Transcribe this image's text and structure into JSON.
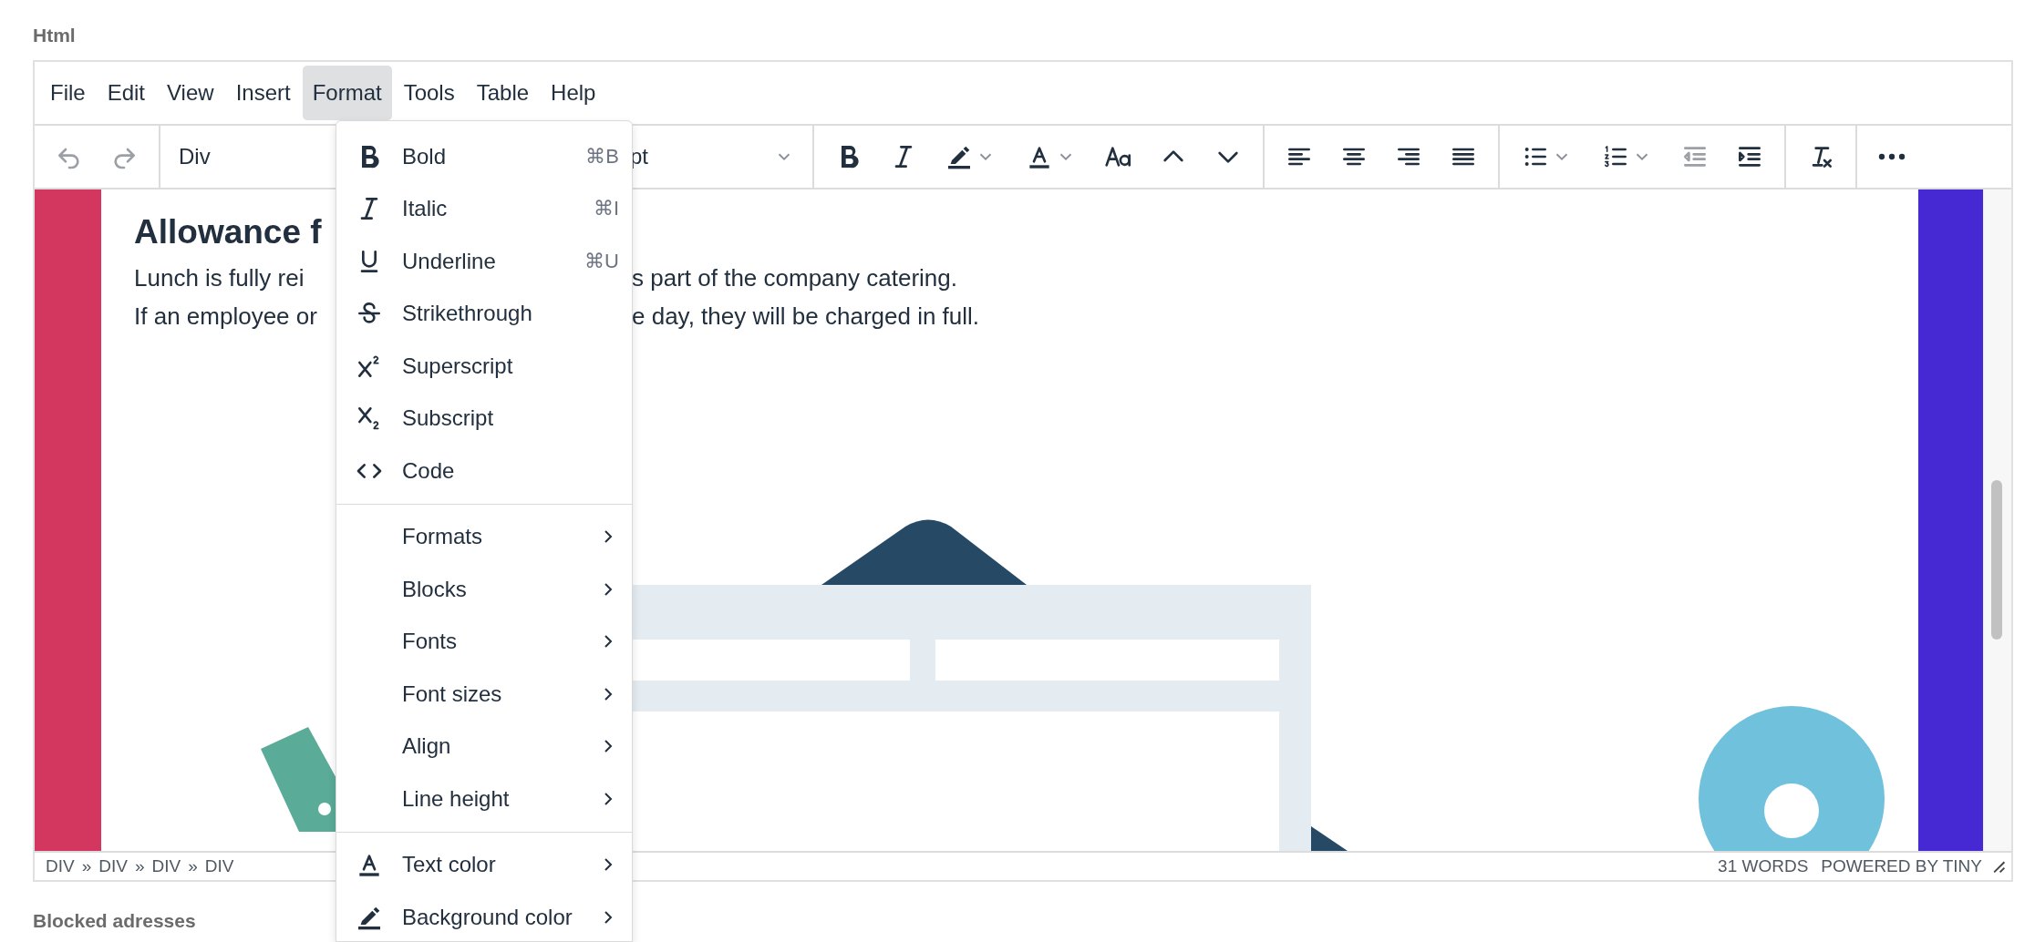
{
  "field_label": "Html",
  "menubar": [
    {
      "label": "File",
      "selected": false
    },
    {
      "label": "Edit",
      "selected": false
    },
    {
      "label": "View",
      "selected": false
    },
    {
      "label": "Insert",
      "selected": false
    },
    {
      "label": "Format",
      "selected": true
    },
    {
      "label": "Tools",
      "selected": false
    },
    {
      "label": "Table",
      "selected": false
    },
    {
      "label": "Help",
      "selected": false
    }
  ],
  "toolbar": {
    "history": [
      {
        "kind": "button",
        "disabled": true
      },
      {
        "kind": "button",
        "disabled": true
      }
    ],
    "selects": [
      {
        "value": "Div"
      },
      {
        "value": "pt"
      }
    ],
    "groups": [
      [
        {
          "kind": "button",
          "disabled": false
        },
        {
          "kind": "button",
          "disabled": false
        },
        {
          "kind": "split",
          "disabled": false
        },
        {
          "kind": "split",
          "disabled": false
        },
        {
          "kind": "button",
          "disabled": false
        },
        {
          "kind": "button",
          "disabled": false
        },
        {
          "kind": "button",
          "disabled": false
        }
      ],
      [
        {
          "kind": "button",
          "disabled": false
        },
        {
          "kind": "button",
          "disabled": false
        },
        {
          "kind": "button",
          "disabled": false
        },
        {
          "kind": "button",
          "disabled": false
        }
      ],
      [
        {
          "kind": "split",
          "disabled": false
        },
        {
          "kind": "split",
          "disabled": false
        },
        {
          "kind": "button",
          "disabled": true
        },
        {
          "kind": "button",
          "disabled": false
        }
      ],
      [
        {
          "kind": "button",
          "disabled": false
        }
      ],
      [
        {
          "kind": "button",
          "disabled": false
        }
      ]
    ]
  },
  "content": {
    "heading": "Allowance f",
    "lines": [
      {
        "left": "Lunch is fully rei",
        "right": "s part of the company catering."
      },
      {
        "left": "If an employee or",
        "right": "e day, they will be charged in full."
      }
    ]
  },
  "status_bar": {
    "path": [
      "DIV",
      "DIV",
      "DIV",
      "DIV"
    ],
    "separator": "»",
    "word_count": "31 WORDS",
    "branding": "POWERED BY TINY"
  },
  "format_menu": {
    "groups": [
      [
        {
          "label": "Bold",
          "shortcut": "⌘B",
          "submenu": false
        },
        {
          "label": "Italic",
          "shortcut": "⌘I",
          "submenu": false
        },
        {
          "label": "Underline",
          "shortcut": "⌘U",
          "submenu": false
        },
        {
          "label": "Strikethrough",
          "submenu": false
        },
        {
          "label": "Superscript",
          "submenu": false
        },
        {
          "label": "Subscript",
          "submenu": false
        },
        {
          "label": "Code",
          "submenu": false
        }
      ],
      [
        {
          "label": "Formats",
          "submenu": true
        },
        {
          "label": "Blocks",
          "submenu": true
        },
        {
          "label": "Fonts",
          "submenu": true
        },
        {
          "label": "Font sizes",
          "submenu": true
        },
        {
          "label": "Align",
          "submenu": true
        },
        {
          "label": "Line height",
          "submenu": true
        }
      ],
      [
        {
          "label": "Text color",
          "submenu": true
        },
        {
          "label": "Background color",
          "submenu": true
        }
      ]
    ]
  },
  "next_field_label": "Blocked adresses"
}
